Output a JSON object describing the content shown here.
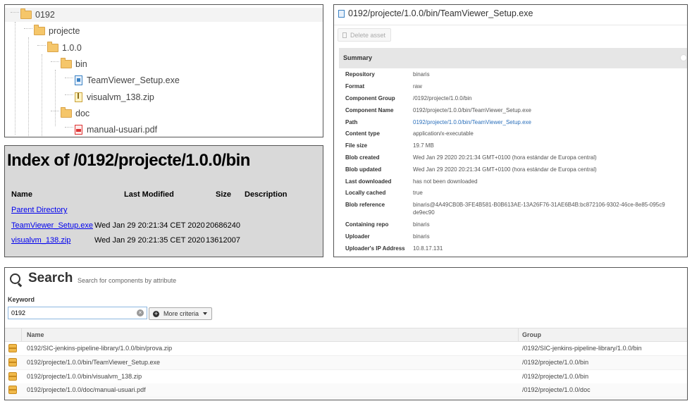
{
  "tree": {
    "items": [
      {
        "label": "0192",
        "type": "folder"
      },
      {
        "label": "projecte",
        "type": "folder"
      },
      {
        "label": "1.0.0",
        "type": "folder"
      },
      {
        "label": "bin",
        "type": "folder"
      },
      {
        "label": "TeamViewer_Setup.exe",
        "type": "exe"
      },
      {
        "label": "visualvm_138.zip",
        "type": "zip"
      },
      {
        "label": "doc",
        "type": "folder"
      },
      {
        "label": "manual-usuari.pdf",
        "type": "pdf"
      }
    ]
  },
  "index": {
    "title": "Index of /0192/projecte/1.0.0/bin",
    "headers": {
      "name": "Name",
      "modified": "Last Modified",
      "size": "Size",
      "description": "Description"
    },
    "parent": "Parent Directory",
    "rows": [
      {
        "name": "TeamViewer_Setup.exe",
        "modified": "Wed Jan 29 20:21:34 CET 2020",
        "size": "20686240"
      },
      {
        "name": "visualvm_138.zip",
        "modified": "Wed Jan 29 20:21:35 CET 2020",
        "size": "13612007"
      }
    ]
  },
  "detail": {
    "title": "0192/projecte/1.0.0/bin/TeamViewer_Setup.exe",
    "delete_label": "Delete asset",
    "summary_label": "Summary",
    "fields": [
      {
        "key": "Repository",
        "value": "binaris"
      },
      {
        "key": "Format",
        "value": "raw"
      },
      {
        "key": "Component Group",
        "value": "/0192/projecte/1.0.0/bin"
      },
      {
        "key": "Component Name",
        "value": "0192/projecte/1.0.0/bin/TeamViewer_Setup.exe"
      },
      {
        "key": "Path",
        "value": "0192/projecte/1.0.0/bin/TeamViewer_Setup.exe"
      },
      {
        "key": "Content type",
        "value": "application/x-executable"
      },
      {
        "key": "File size",
        "value": "19.7 MB"
      },
      {
        "key": "Blob created",
        "value": "Wed Jan 29 2020 20:21:34 GMT+0100 (hora estándar de Europa central)"
      },
      {
        "key": "Blob updated",
        "value": "Wed Jan 29 2020 20:21:34 GMT+0100 (hora estándar de Europa central)"
      },
      {
        "key": "Last downloaded",
        "value": "has not been downloaded"
      },
      {
        "key": "Locally cached",
        "value": "true"
      },
      {
        "key": "Blob reference",
        "value": "binaris@4A49CB0B-3FE4B581-B0B613AE-13A26F76-31AE6B4B:bc872106-9302-46ce-8e85-095c9",
        "value2": "de9ec90"
      },
      {
        "key": "Containing repo",
        "value": "binaris"
      },
      {
        "key": "Uploader",
        "value": "binaris"
      },
      {
        "key": "Uploader's IP Address",
        "value": "10.8.17.131"
      }
    ]
  },
  "search": {
    "title": "Search",
    "subtitle": "Search for components by attribute",
    "keyword_label": "Keyword",
    "keyword_value": "0192",
    "more_criteria_label": "More criteria",
    "columns": {
      "name": "Name",
      "group": "Group"
    },
    "results": [
      {
        "name": "0192/SIC-jenkins-pipeline-library/1.0.0/bin/prova.zip",
        "group": "/0192/SIC-jenkins-pipeline-library/1.0.0/bin"
      },
      {
        "name": "0192/projecte/1.0.0/bin/TeamViewer_Setup.exe",
        "group": "/0192/projecte/1.0.0/bin"
      },
      {
        "name": "0192/projecte/1.0.0/bin/visualvm_138.zip",
        "group": "/0192/projecte/1.0.0/bin"
      },
      {
        "name": "0192/projecte/1.0.0/doc/manual-usuari.pdf",
        "group": "/0192/projecte/1.0.0/doc"
      }
    ]
  }
}
